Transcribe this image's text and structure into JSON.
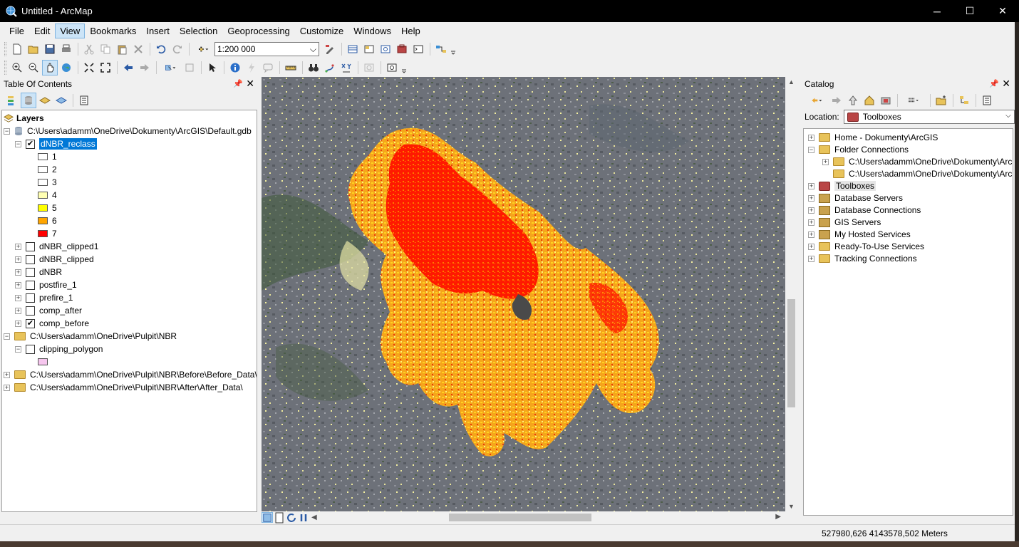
{
  "window": {
    "title": "Untitled - ArcMap",
    "minimize": "─",
    "maximize": "☐",
    "close": "✕"
  },
  "menu": [
    "File",
    "Edit",
    "View",
    "Bookmarks",
    "Insert",
    "Selection",
    "Geoprocessing",
    "Customize",
    "Windows",
    "Help"
  ],
  "active_menu": "View",
  "toolbar": {
    "scale": "1:200 000"
  },
  "toc": {
    "title": "Table Of Contents",
    "root_label": "Layers",
    "gdb_path": "C:\\Users\\adamm\\OneDrive\\Dokumenty\\ArcGIS\\Default.gdb",
    "selected_layer": "dNBR_reclass",
    "classes": [
      {
        "label": "1",
        "color": "#ffffff"
      },
      {
        "label": "2",
        "color": "#ffffff"
      },
      {
        "label": "3",
        "color": "#ffffff"
      },
      {
        "label": "4",
        "color": "#ffffb3"
      },
      {
        "label": "5",
        "color": "#ffff00"
      },
      {
        "label": "6",
        "color": "#ffa500"
      },
      {
        "label": "7",
        "color": "#ff0000"
      }
    ],
    "layers": [
      {
        "label": "dNBR_clipped1",
        "checked": false
      },
      {
        "label": "dNBR_clipped",
        "checked": false
      },
      {
        "label": "dNBR",
        "checked": false
      },
      {
        "label": "postfire_1",
        "checked": false
      },
      {
        "label": "prefire_1",
        "checked": false
      },
      {
        "label": "comp_after",
        "checked": false
      },
      {
        "label": "comp_before",
        "checked": true
      }
    ],
    "nbr_path": "C:\\Users\\adamm\\OneDrive\\Pulpit\\NBR",
    "clipping_layer": "clipping_polygon",
    "clipping_color": "#f6c6ee",
    "before_path": "C:\\Users\\adamm\\OneDrive\\Pulpit\\NBR\\Before\\Before_Data\\",
    "after_path": "C:\\Users\\adamm\\OneDrive\\Pulpit\\NBR\\After\\After_Data\\"
  },
  "catalog": {
    "title": "Catalog",
    "location_label": "Location:",
    "location_value": "Toolboxes",
    "items": [
      {
        "label": "Home - Dokumenty\\ArcGIS"
      },
      {
        "label": "Folder Connections"
      },
      {
        "label": "C:\\Users\\adamm\\OneDrive\\Dokumenty\\ArcGIS"
      },
      {
        "label": "C:\\Users\\adamm\\OneDrive\\Dokumenty\\ArcGIS"
      },
      {
        "label": "Toolboxes"
      },
      {
        "label": "Database Servers"
      },
      {
        "label": "Database Connections"
      },
      {
        "label": "GIS Servers"
      },
      {
        "label": "My Hosted Services"
      },
      {
        "label": "Ready-To-Use Services"
      },
      {
        "label": "Tracking Connections"
      }
    ]
  },
  "status": {
    "coordinates": "527980,626  4143578,502 Meters"
  }
}
